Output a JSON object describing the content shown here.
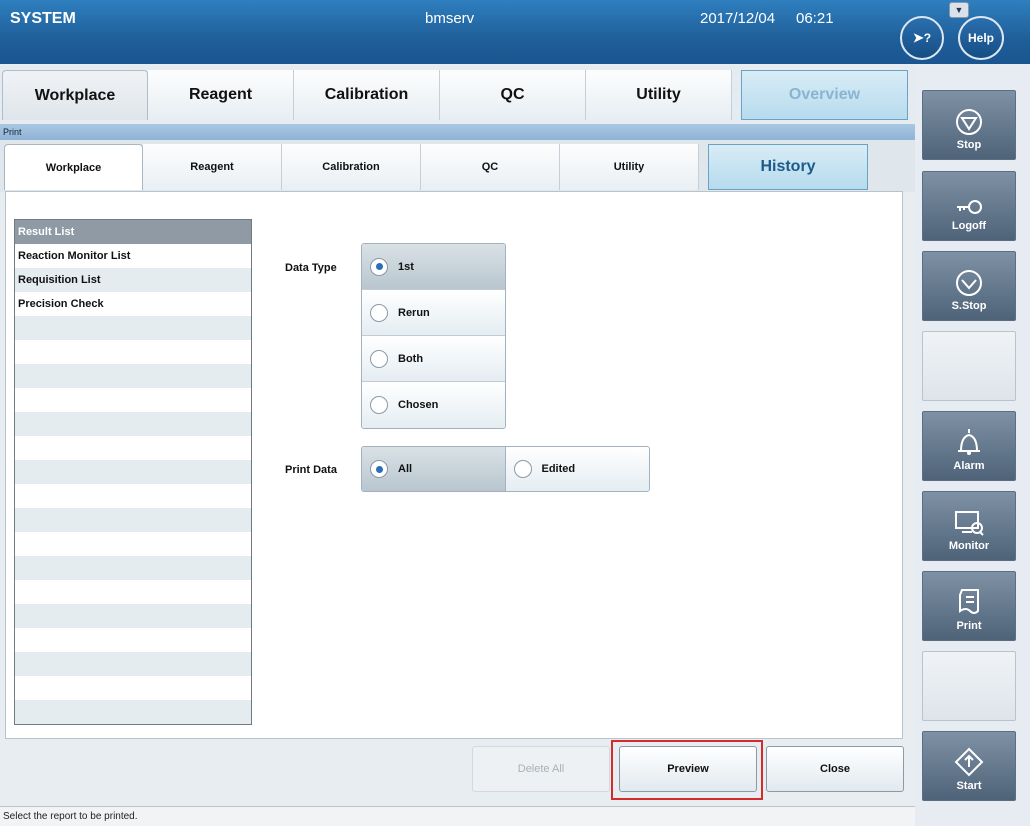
{
  "topbar": {
    "system": "SYSTEM",
    "host": "bmserv",
    "date": "2017/12/04",
    "time": "06:21",
    "help_label": "Help",
    "whatsthis_label": "?"
  },
  "main_tabs": [
    "Workplace",
    "Reagent",
    "Calibration",
    "QC",
    "Utility",
    "Overview"
  ],
  "print_title": "Print",
  "sub_tabs": [
    "Workplace",
    "Reagent",
    "Calibration",
    "QC",
    "Utility",
    "History"
  ],
  "report_list": {
    "items": [
      "Result List",
      "Reaction Monitor List",
      "Requisition List",
      "Precision Check"
    ],
    "selected": "Result List"
  },
  "data_type": {
    "label": "Data Type",
    "options": [
      "1st",
      "Rerun",
      "Both",
      "Chosen"
    ],
    "selected": "1st"
  },
  "print_data": {
    "label": "Print Data",
    "options": [
      "All",
      "Edited"
    ],
    "selected": "All"
  },
  "buttons": {
    "delete_all": "Delete All",
    "preview": "Preview",
    "close": "Close"
  },
  "status_text": "Select the report to be printed.",
  "side_buttons": {
    "stop": "Stop",
    "logoff": "Logoff",
    "sstop": "S.Stop",
    "alarm": "Alarm",
    "monitor": "Monitor",
    "print": "Print",
    "start": "Start"
  }
}
